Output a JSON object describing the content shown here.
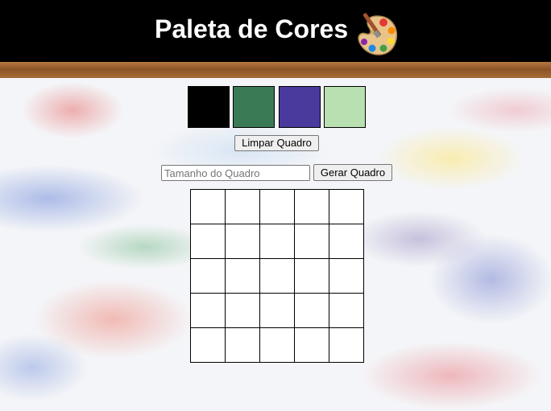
{
  "header": {
    "title": "Paleta de Cores",
    "icon": "artist-palette-icon"
  },
  "palette": {
    "colors": [
      "#000000",
      "#3a7b56",
      "#4a3a9e",
      "#b8e0b0"
    ]
  },
  "controls": {
    "clear_label": "Limpar Quadro",
    "size_placeholder": "Tamanho do Quadro",
    "size_value": "",
    "generate_label": "Gerar Quadro"
  },
  "board": {
    "rows": 5,
    "cols": 5,
    "pixel_color": "#ffffff"
  }
}
